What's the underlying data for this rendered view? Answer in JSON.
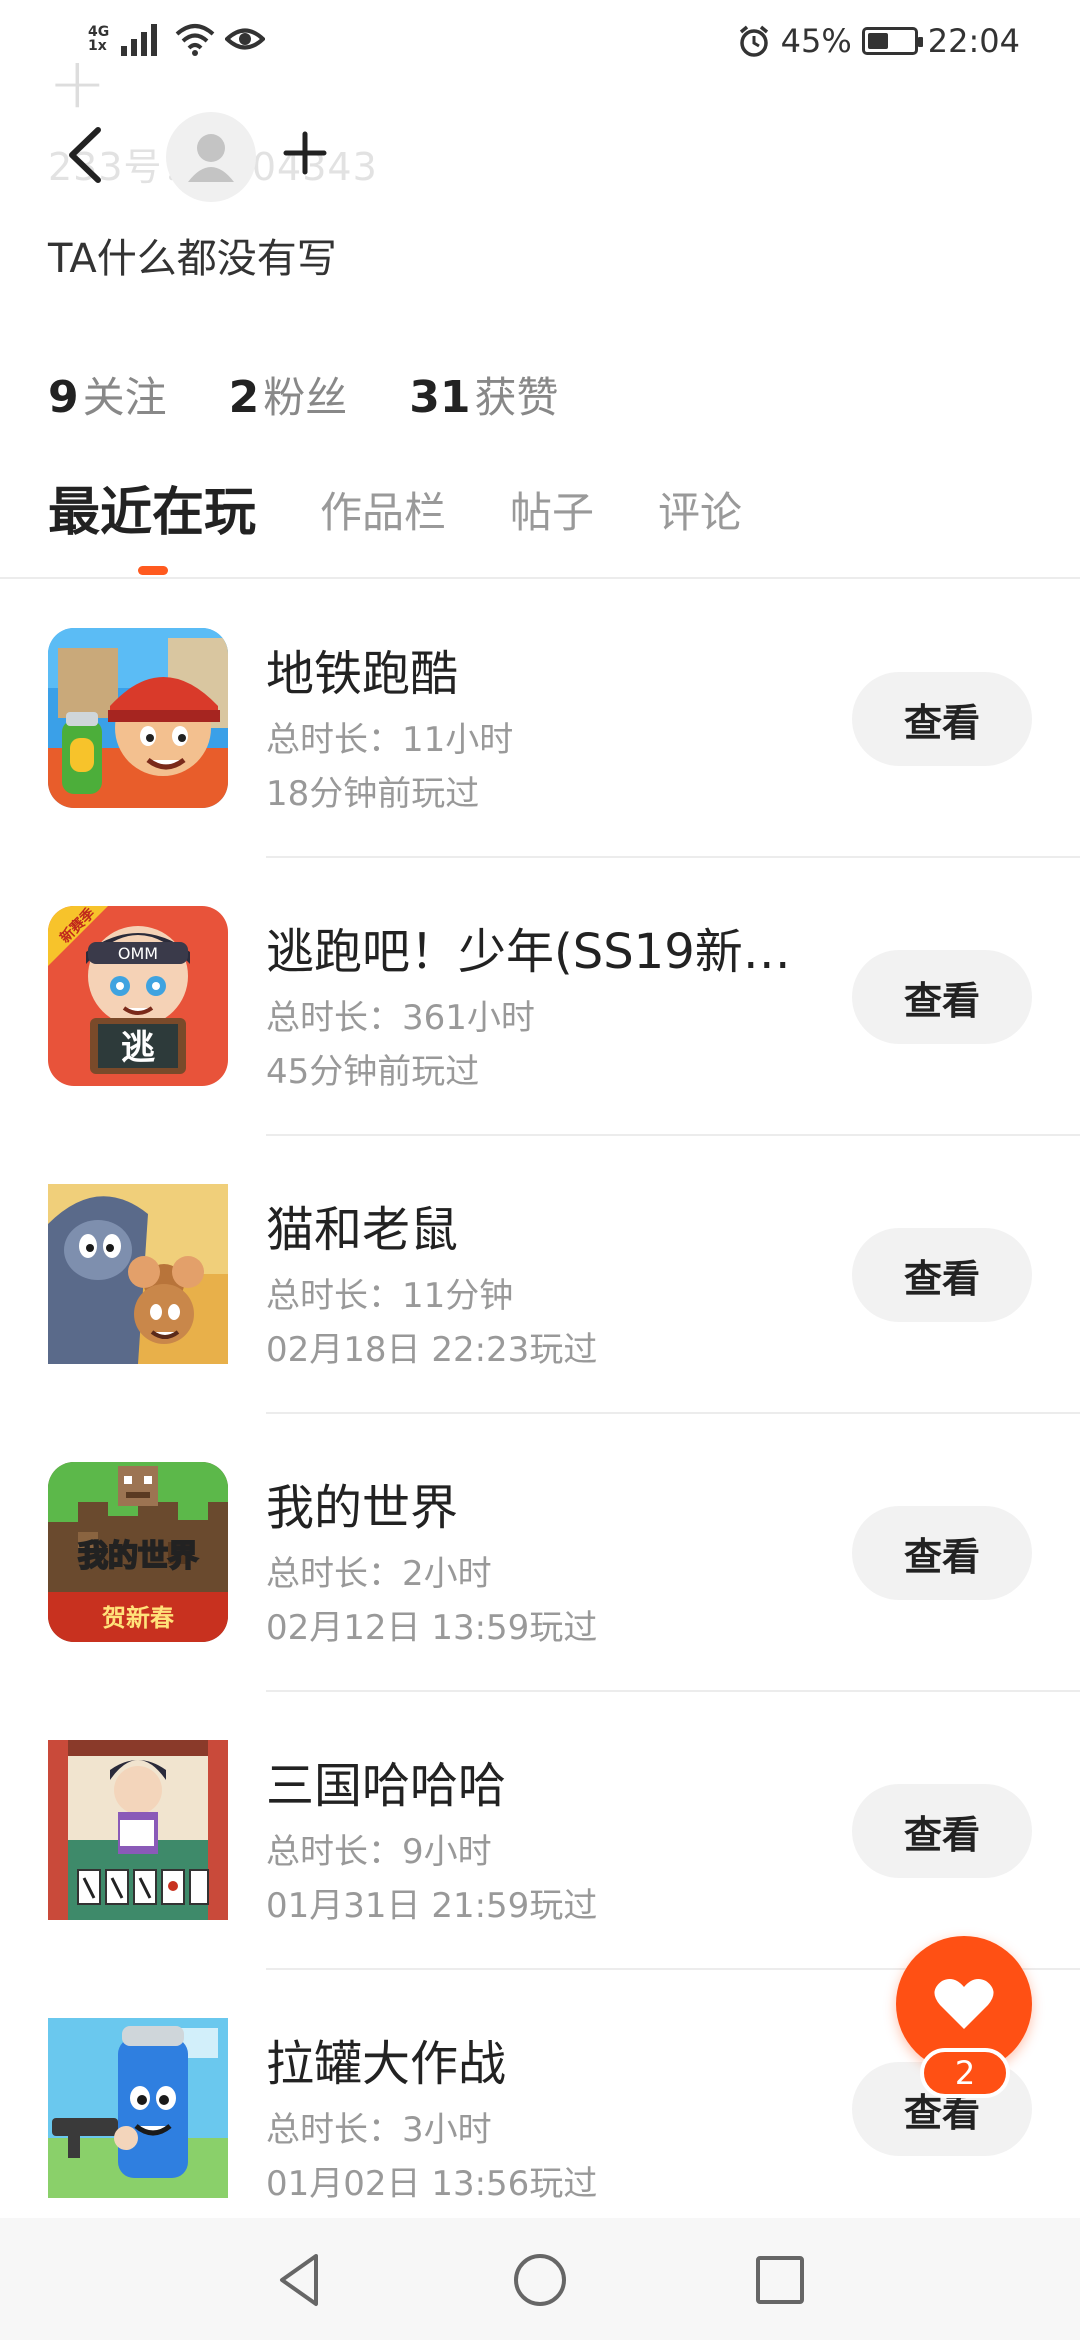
{
  "status_bar": {
    "network_top": "4G",
    "network_bottom": "1x",
    "battery_percent": "45%",
    "time": "22:04",
    "icons": [
      "signal-icon",
      "wifi-icon",
      "eye-icon",
      "alarm-icon",
      "battery-icon"
    ]
  },
  "header": {
    "faded_id_text": "233号：2404343",
    "bio": "TA什么都没有写"
  },
  "stats": [
    {
      "num": "9",
      "label": "关注"
    },
    {
      "num": "2",
      "label": "粉丝"
    },
    {
      "num": "31",
      "label": "获赞"
    }
  ],
  "tabs": [
    {
      "label": "最近在玩",
      "active": true
    },
    {
      "label": "作品栏",
      "active": false
    },
    {
      "label": "帖子",
      "active": false
    },
    {
      "label": "评论",
      "active": false
    }
  ],
  "accent_color": "#ff5014",
  "games": [
    {
      "title": "地铁跑酷",
      "duration": "总时长：11小时",
      "last_played": "18分钟前玩过",
      "button": "查看",
      "icon": "subway-surfers-icon"
    },
    {
      "title": "逃跑吧！少年(SS19新赛...",
      "duration": "总时长：361小时",
      "last_played": "45分钟前玩过",
      "button": "查看",
      "icon": "escape-boy-icon"
    },
    {
      "title": "猫和老鼠",
      "duration": "总时长：11分钟",
      "last_played": "02月18日 22:23玩过",
      "button": "查看",
      "icon": "tom-and-jerry-icon"
    },
    {
      "title": "我的世界",
      "duration": "总时长：2小时",
      "last_played": "02月12日 13:59玩过",
      "button": "查看",
      "icon": "minecraft-icon"
    },
    {
      "title": "三国哈哈哈",
      "duration": "总时长：9小时",
      "last_played": "01月31日 21:59玩过",
      "button": "查看",
      "icon": "sanguo-hahaha-icon"
    },
    {
      "title": "拉罐大作战",
      "duration": "总时长：3小时",
      "last_played": "01月02日 13:56玩过",
      "button": "查看",
      "icon": "can-battle-icon"
    }
  ],
  "minecraft_icon_text": {
    "top": "我的世界",
    "bottom": "贺新春"
  },
  "escape_icon_text": {
    "ribbon": "新赛季",
    "brand": "OMM",
    "sign": "逃"
  },
  "like_fab": {
    "badge": "2"
  }
}
